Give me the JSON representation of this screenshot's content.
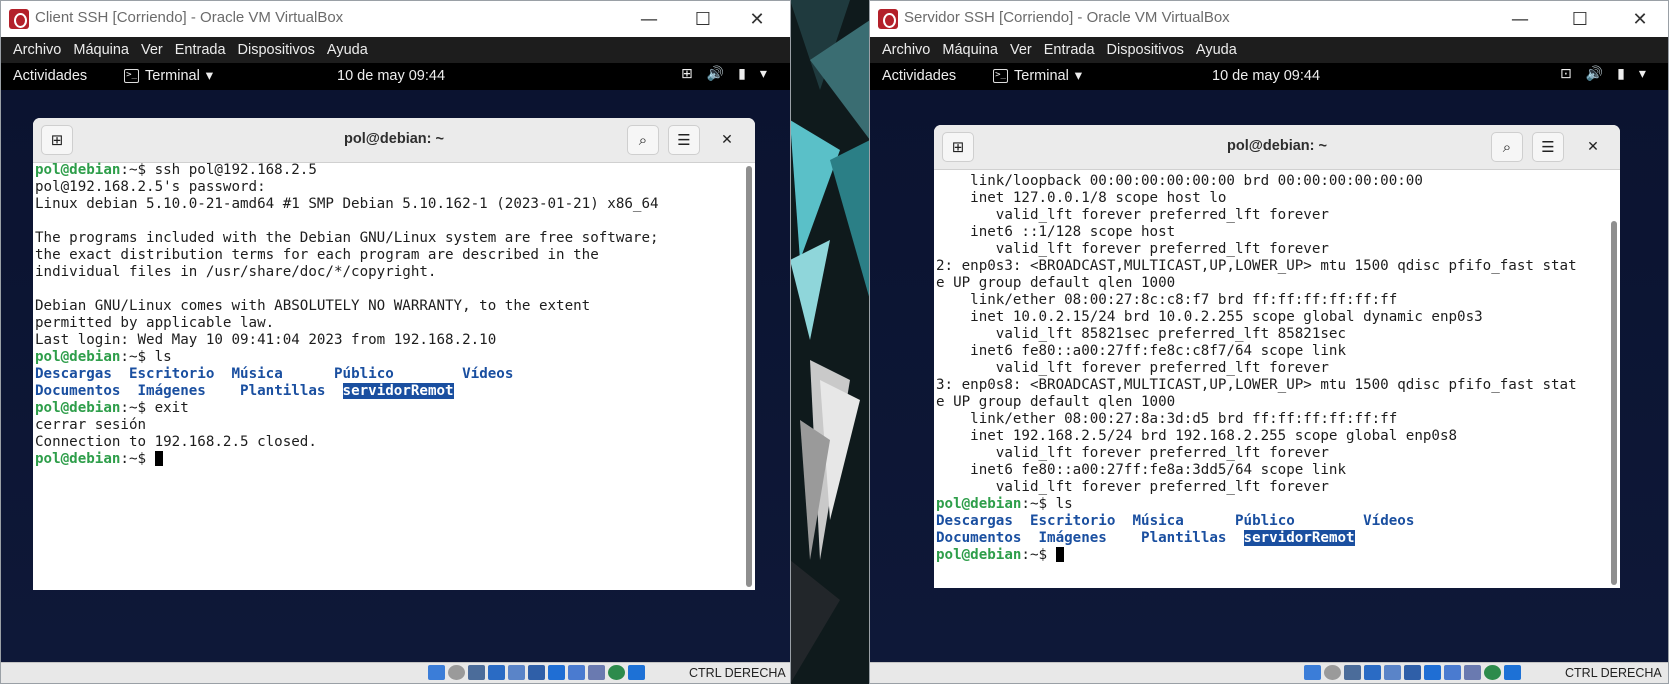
{
  "windows": [
    {
      "title": "Client SSH [Corriendo] - Oracle VM VirtualBox",
      "menu": [
        "Archivo",
        "Máquina",
        "Ver",
        "Entrada",
        "Dispositivos",
        "Ayuda"
      ],
      "topbar": {
        "activities": "Actividades",
        "app": "Terminal",
        "clock": "10 de may  09:44"
      },
      "terminal": {
        "title": "pol@debian: ~",
        "lines": [
          [
            [
              "p",
              "pol@debian"
            ],
            [
              "t",
              ":~$ ssh pol@192.168.2.5"
            ]
          ],
          [
            [
              "t",
              "pol@192.168.2.5's password:"
            ]
          ],
          [
            [
              "t",
              "Linux debian 5.10.0-21-amd64 #1 SMP Debian 5.10.162-1 (2023-01-21) x86_64"
            ]
          ],
          [
            [
              "t",
              ""
            ]
          ],
          [
            [
              "t",
              "The programs included with the Debian GNU/Linux system are free software;"
            ]
          ],
          [
            [
              "t",
              "the exact distribution terms for each program are described in the"
            ]
          ],
          [
            [
              "t",
              "individual files in /usr/share/doc/*/copyright."
            ]
          ],
          [
            [
              "t",
              ""
            ]
          ],
          [
            [
              "t",
              "Debian GNU/Linux comes with ABSOLUTELY NO WARRANTY, to the extent"
            ]
          ],
          [
            [
              "t",
              "permitted by applicable law."
            ]
          ],
          [
            [
              "t",
              "Last login: Wed May 10 09:41:04 2023 from 192.168.2.10"
            ]
          ],
          [
            [
              "p",
              "pol@debian"
            ],
            [
              "t",
              ":~$ ls"
            ]
          ],
          [
            [
              "b",
              "Descargas"
            ],
            [
              "t",
              "  "
            ],
            [
              "b",
              "Escritorio"
            ],
            [
              "t",
              "  "
            ],
            [
              "b",
              "Música"
            ],
            [
              "t",
              "      "
            ],
            [
              "b",
              "Público"
            ],
            [
              "t",
              "        "
            ],
            [
              "b",
              "Vídeos"
            ]
          ],
          [
            [
              "b",
              "Documentos"
            ],
            [
              "t",
              "  "
            ],
            [
              "b",
              "Imágenes"
            ],
            [
              "t",
              "    "
            ],
            [
              "b",
              "Plantillas"
            ],
            [
              "t",
              "  "
            ],
            [
              "h",
              "servidorRemot"
            ]
          ],
          [
            [
              "p",
              "pol@debian"
            ],
            [
              "t",
              ":~$ exit"
            ]
          ],
          [
            [
              "t",
              "cerrar sesión"
            ]
          ],
          [
            [
              "t",
              "Connection to 192.168.2.5 closed."
            ]
          ],
          [
            [
              "p",
              "pol@debian"
            ],
            [
              "t",
              ":~$ "
            ],
            [
              "c",
              ""
            ]
          ]
        ]
      },
      "status_text": "CTRL DERECHA"
    },
    {
      "title": "Servidor SSH [Corriendo] - Oracle VM VirtualBox",
      "menu": [
        "Archivo",
        "Máquina",
        "Ver",
        "Entrada",
        "Dispositivos",
        "Ayuda"
      ],
      "topbar": {
        "activities": "Actividades",
        "app": "Terminal",
        "clock": "10 de may  09:44"
      },
      "terminal": {
        "title": "pol@debian: ~",
        "lines": [
          [
            [
              "t",
              "    link/loopback 00:00:00:00:00:00 brd 00:00:00:00:00:00"
            ]
          ],
          [
            [
              "t",
              "    inet 127.0.0.1/8 scope host lo"
            ]
          ],
          [
            [
              "t",
              "       valid_lft forever preferred_lft forever"
            ]
          ],
          [
            [
              "t",
              "    inet6 ::1/128 scope host"
            ]
          ],
          [
            [
              "t",
              "       valid_lft forever preferred_lft forever"
            ]
          ],
          [
            [
              "t",
              "2: enp0s3: <BROADCAST,MULTICAST,UP,LOWER_UP> mtu 1500 qdisc pfifo_fast stat"
            ]
          ],
          [
            [
              "t",
              "e UP group default qlen 1000"
            ]
          ],
          [
            [
              "t",
              "    link/ether 08:00:27:8c:c8:f7 brd ff:ff:ff:ff:ff:ff"
            ]
          ],
          [
            [
              "t",
              "    inet 10.0.2.15/24 brd 10.0.2.255 scope global dynamic enp0s3"
            ]
          ],
          [
            [
              "t",
              "       valid_lft 85821sec preferred_lft 85821sec"
            ]
          ],
          [
            [
              "t",
              "    inet6 fe80::a00:27ff:fe8c:c8f7/64 scope link"
            ]
          ],
          [
            [
              "t",
              "       valid_lft forever preferred_lft forever"
            ]
          ],
          [
            [
              "t",
              "3: enp0s8: <BROADCAST,MULTICAST,UP,LOWER_UP> mtu 1500 qdisc pfifo_fast stat"
            ]
          ],
          [
            [
              "t",
              "e UP group default qlen 1000"
            ]
          ],
          [
            [
              "t",
              "    link/ether 08:00:27:8a:3d:d5 brd ff:ff:ff:ff:ff:ff"
            ]
          ],
          [
            [
              "t",
              "    inet 192.168.2.5/24 brd 192.168.2.255 scope global enp0s8"
            ]
          ],
          [
            [
              "t",
              "       valid_lft forever preferred_lft forever"
            ]
          ],
          [
            [
              "t",
              "    inet6 fe80::a00:27ff:fe8a:3dd5/64 scope link"
            ]
          ],
          [
            [
              "t",
              "       valid_lft forever preferred_lft forever"
            ]
          ],
          [
            [
              "p",
              "pol@debian"
            ],
            [
              "t",
              ":~$ ls"
            ]
          ],
          [
            [
              "b",
              "Descargas"
            ],
            [
              "t",
              "  "
            ],
            [
              "b",
              "Escritorio"
            ],
            [
              "t",
              "  "
            ],
            [
              "b",
              "Música"
            ],
            [
              "t",
              "      "
            ],
            [
              "b",
              "Público"
            ],
            [
              "t",
              "        "
            ],
            [
              "b",
              "Vídeos"
            ]
          ],
          [
            [
              "b",
              "Documentos"
            ],
            [
              "t",
              "  "
            ],
            [
              "b",
              "Imágenes"
            ],
            [
              "t",
              "    "
            ],
            [
              "b",
              "Plantillas"
            ],
            [
              "t",
              "  "
            ],
            [
              "h",
              "servidorRemot"
            ]
          ],
          [
            [
              "p",
              "pol@debian"
            ],
            [
              "t",
              ":~$ "
            ],
            [
              "c",
              ""
            ]
          ]
        ]
      },
      "status_text": "CTRL DERECHA"
    }
  ],
  "icons": [
    "terminal-icon",
    "network-icon",
    "volume-icon",
    "battery-icon",
    "menu-icon",
    "new-tab-icon",
    "search-icon",
    "hamburger-icon",
    "close-icon",
    "minimize-icon",
    "maximize-icon"
  ],
  "colors": {
    "prompt": "#2e9e4a",
    "directory": "#1a4fa0",
    "guest_bg": "#0d1530",
    "menubar": "#1d1d1d"
  }
}
